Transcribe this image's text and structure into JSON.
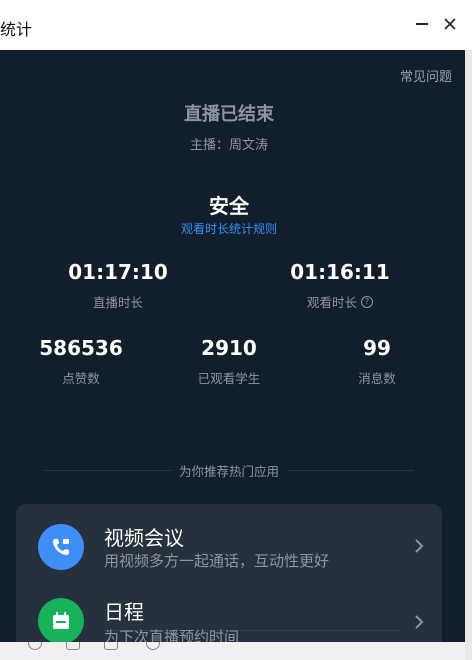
{
  "window": {
    "title": "统计"
  },
  "faq_label": "常见问题",
  "live": {
    "status": "直播已结束",
    "host_label": "主播：周文涛"
  },
  "safety": {
    "status": "安全",
    "rules_link": "观看时长统计规则"
  },
  "stats": {
    "live_duration": {
      "value": "01:17:10",
      "label": "直播时长"
    },
    "watch_duration": {
      "value": "01:16:11",
      "label": "观看时长"
    },
    "likes": {
      "value": "586536",
      "label": "点赞数"
    },
    "students": {
      "value": "2910",
      "label": "已观看学生"
    },
    "messages": {
      "value": "99",
      "label": "消息数"
    }
  },
  "recommend": {
    "heading": "为你推荐热门应用",
    "apps": [
      {
        "name": "视频会议",
        "desc": "用视频多方一起通话，互动性更好",
        "icon": "video-call-icon",
        "color": "#3e8ef7"
      },
      {
        "name": "日程",
        "desc": "为下次直播预约时间",
        "icon": "calendar-icon",
        "color": "#16b35a"
      }
    ]
  }
}
